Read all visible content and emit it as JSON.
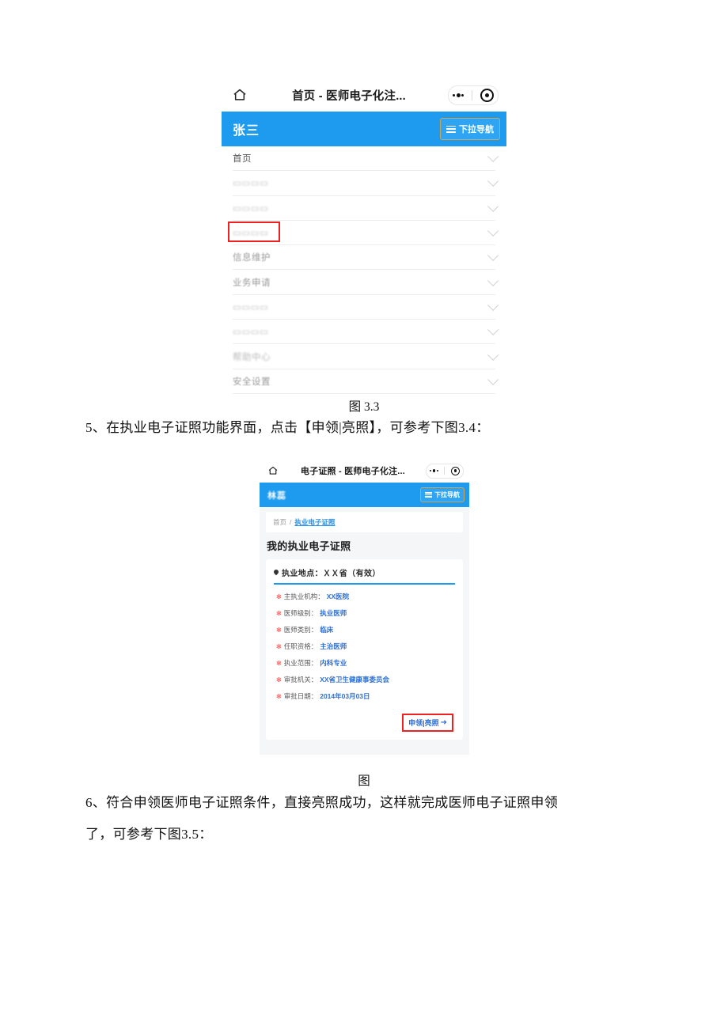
{
  "figure_3_3": {
    "topbar": {
      "home_icon": "home-icon",
      "title": "首页  - 医师电子化注...",
      "capsule_more_icon": "more-dots-icon",
      "capsule_target_icon": "target-circle-icon"
    },
    "blue_bar": {
      "username": "张三",
      "nav_button_label": "下拉导航",
      "nav_button_icon": "hamburger-icon"
    },
    "menu_items": [
      {
        "label": "首页",
        "style": "normal",
        "highlighted": false
      },
      {
        "label": "▭▭▭▭",
        "style": "blurred",
        "highlighted": false
      },
      {
        "label": "▭▭▭▭",
        "style": "blurred",
        "highlighted": false
      },
      {
        "label": "▭▭▭▭",
        "style": "blurred",
        "highlighted": true
      },
      {
        "label": "信息维护",
        "style": "faint",
        "highlighted": false
      },
      {
        "label": "业务申请",
        "style": "faint",
        "highlighted": false
      },
      {
        "label": "▭▭▭▭",
        "style": "blurred",
        "highlighted": false
      },
      {
        "label": "▭▭▭▭",
        "style": "blurred",
        "highlighted": false
      },
      {
        "label": "帮助中心",
        "style": "blurred",
        "highlighted": false
      },
      {
        "label": "安全设置",
        "style": "faint",
        "highlighted": false
      }
    ],
    "caption": "图 3.3"
  },
  "paragraph_5": "5、在执业电子证照功能界面，点击【申领|亮照】，可参考下图3.4：",
  "figure_3_4": {
    "topbar": {
      "home_icon": "home-icon",
      "title": "电子证照 - 医师电子化注...",
      "capsule_more_icon": "more-dots-icon",
      "capsule_target_icon": "target-circle-icon"
    },
    "blue_bar": {
      "username": "林蕊",
      "nav_button_label": "下拉导航",
      "nav_button_icon": "hamburger-icon"
    },
    "breadcrumb": {
      "root": "首页",
      "separator": "/",
      "current": "执业电子证照"
    },
    "page_title": "我的执业电子证照",
    "card": {
      "location_icon": "location-pin-icon",
      "location_text": "执业地点：ＸＸ省（有效）",
      "rows": [
        {
          "label": "主执业机构：",
          "value": "XX医院"
        },
        {
          "label": "医师级别：",
          "value": "执业医师"
        },
        {
          "label": "医师类别：",
          "value": "临床"
        },
        {
          "label": "任职资格：",
          "value": "主治医师"
        },
        {
          "label": "执业范围：",
          "value": "内科专业"
        },
        {
          "label": "审批机关：",
          "value": "XX省卫生健康事委员会"
        },
        {
          "label": "审批日期：",
          "value": "2014年03月03日"
        }
      ],
      "claim_label": "申领|亮照",
      "claim_arrow": "➜"
    },
    "caption": "图"
  },
  "paragraph_6_line1": "6、符合申领医师电子证照条件，直接亮照成功，这样就完成医师电子证照申领",
  "paragraph_6_line2": "了，可参考下图3.5：",
  "colors": {
    "brand_blue": "#1E9BEF",
    "link_blue": "#2f6fd0",
    "highlight_red": "#ee2222",
    "asterisk_red": "#f04a4a",
    "page_bg": "#f4f6f8"
  }
}
